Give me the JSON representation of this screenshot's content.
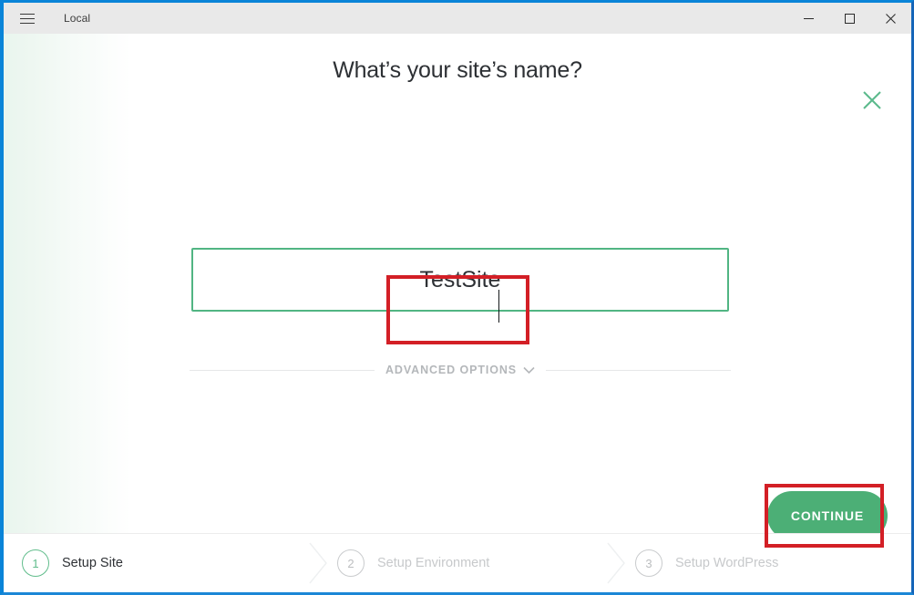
{
  "window": {
    "app_title": "Local",
    "menu_icon": "hamburger-icon",
    "controls": {
      "minimize": "minimize-icon",
      "maximize": "maximize-icon",
      "close": "close-icon"
    }
  },
  "main": {
    "heading": "What’s your site’s name?",
    "close_icon": "close-icon",
    "site_name_input": {
      "value": "TestSite",
      "placeholder": "",
      "border_color": "#51b583",
      "focused": true
    },
    "advanced_options": {
      "label": "ADVANCED OPTIONS",
      "chevron_icon": "chevron-down-icon",
      "expanded": false
    },
    "continue_button": {
      "label": "CONTINUE",
      "color": "#4caf76"
    },
    "annotations": {
      "color": "#d31f26",
      "targets": [
        "site-name-input",
        "continue-button"
      ]
    }
  },
  "stepper": {
    "steps": [
      {
        "number": "1",
        "label": "Setup Site",
        "active": true
      },
      {
        "number": "2",
        "label": "Setup Environment",
        "active": false
      },
      {
        "number": "3",
        "label": "Setup WordPress",
        "active": false
      }
    ],
    "active_color": "#61bd8c",
    "inactive_color": "#c7c9cb"
  }
}
